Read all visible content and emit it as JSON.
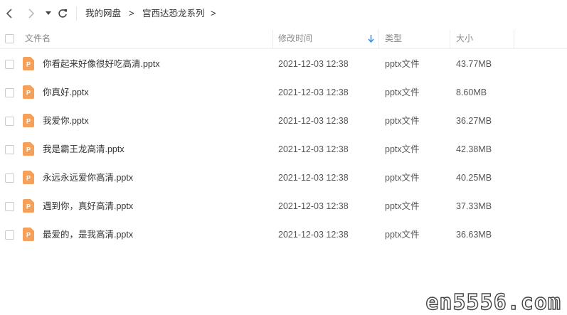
{
  "toolbar": {
    "back_icon": "chevron-left-icon",
    "forward_icon": "chevron-right-icon",
    "history_icon": "caret-down-icon",
    "refresh_icon": "refresh-icon",
    "breadcrumb": [
      "我的网盘",
      "宫西达恐龙系列"
    ],
    "separator": ">"
  },
  "columns": {
    "name": "文件名",
    "modified": "修改时间",
    "type": "类型",
    "size": "大小",
    "sort_icon": "sort-down-arrow-icon",
    "sort_color": "#2b8ef3"
  },
  "files": [
    {
      "name": "你看起来好像很好吃高清.pptx",
      "modified": "2021-12-03 12:38",
      "type": "pptx文件",
      "size": "43.77MB"
    },
    {
      "name": "你真好.pptx",
      "modified": "2021-12-03 12:38",
      "type": "pptx文件",
      "size": "8.60MB"
    },
    {
      "name": "我爱你.pptx",
      "modified": "2021-12-03 12:38",
      "type": "pptx文件",
      "size": "36.27MB"
    },
    {
      "name": "我是霸王龙高清.pptx",
      "modified": "2021-12-03 12:38",
      "type": "pptx文件",
      "size": "42.38MB"
    },
    {
      "name": "永远永远爱你高清.pptx",
      "modified": "2021-12-03 12:38",
      "type": "pptx文件",
      "size": "40.25MB"
    },
    {
      "name": "遇到你，真好高清.pptx",
      "modified": "2021-12-03 12:38",
      "type": "pptx文件",
      "size": "37.33MB"
    },
    {
      "name": "最爱的，是我高清.pptx",
      "modified": "2021-12-03 12:38",
      "type": "pptx文件",
      "size": "36.63MB"
    }
  ],
  "file_icon": {
    "name": "ppt-file-icon",
    "color": "#f5a15b",
    "letter": "P"
  },
  "watermark": "en5556.com"
}
